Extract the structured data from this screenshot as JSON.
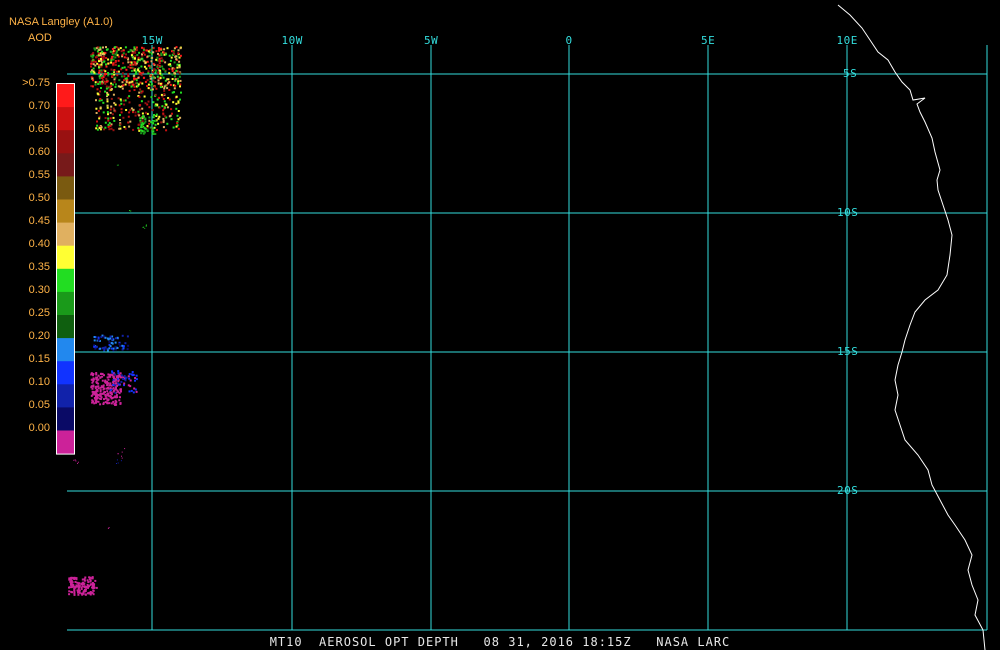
{
  "header": {
    "producer": "NASA Langley (A1.0)",
    "product": "AOD"
  },
  "colorbar": {
    "labels": [
      ">0.75",
      "0.70",
      "0.65",
      "0.60",
      "0.55",
      "0.50",
      "0.45",
      "0.40",
      "0.35",
      "0.30",
      "0.25",
      "0.20",
      "0.15",
      "0.10",
      "0.05",
      "0.00"
    ],
    "colors": [
      "#ff1a1a",
      "#cc1111",
      "#991111",
      "#771a1a",
      "#7a5a10",
      "#b8861b",
      "#e0b060",
      "#ffff33",
      "#22dd22",
      "#1a9a1a",
      "#0f5f0f",
      "#2288ee",
      "#1133ff",
      "#1122aa",
      "#0a0a66",
      "#cc2299"
    ]
  },
  "grid": {
    "color": "#33dddd",
    "lon_labels": [
      "15W",
      "10W",
      "5W",
      "0",
      "5E",
      "10E"
    ],
    "lat_labels": [
      "5S",
      "10S",
      "15S",
      "20S"
    ]
  },
  "coastline_color": "#ffffff",
  "footer": {
    "text": "MT10  AEROSOL OPT DEPTH   08 31, 2016 18:15Z   NASA LARC"
  }
}
